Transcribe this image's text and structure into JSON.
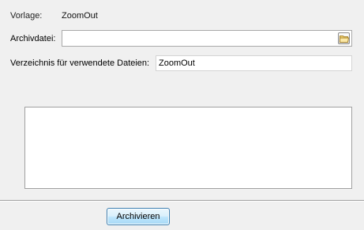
{
  "template": {
    "label": "Vorlage:",
    "value": "ZoomOut"
  },
  "archive_file": {
    "label": "Archivdatei:",
    "value": "",
    "browse_icon": "folder-icon"
  },
  "directory": {
    "label": "Verzeichnis für verwendete Dateien:",
    "value": "ZoomOut"
  },
  "log": {
    "text": ""
  },
  "actions": {
    "archive_label": "Archivieren"
  },
  "colors": {
    "background": "#f0f0f0",
    "button_border": "#3c7fb1",
    "button_fill": "#bee6fd"
  }
}
